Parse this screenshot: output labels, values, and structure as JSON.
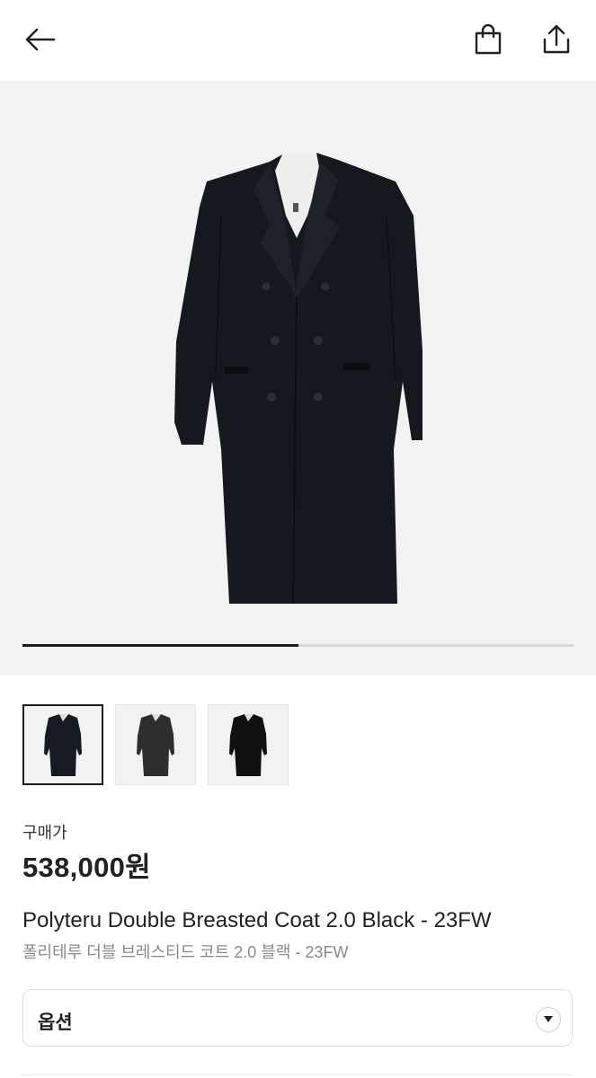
{
  "header": {
    "back_icon": "arrow-left-icon",
    "bag_icon": "shopping-bag-icon",
    "share_icon": "share-upload-icon"
  },
  "gallery": {
    "slide_progress": 0.5,
    "thumbnails": [
      {
        "name": "coat-front-navy",
        "selected": true
      },
      {
        "name": "coat-front-charcoal",
        "selected": false
      },
      {
        "name": "coat-front-black",
        "selected": false
      }
    ]
  },
  "product": {
    "price_label": "구매가",
    "price": "538,000원",
    "title_en": "Polyteru Double Breasted Coat 2.0 Black - 23FW",
    "title_ko": "폴리테루 더블 브레스티드 코트 2.0 블랙 - 23FW"
  },
  "options": {
    "label": "옵션",
    "chevron_icon": "chevron-down-icon"
  },
  "colors": {
    "accent": "#1c1c1c",
    "muted_text": "#8a8a8a",
    "image_bg": "#f2f2f2"
  }
}
